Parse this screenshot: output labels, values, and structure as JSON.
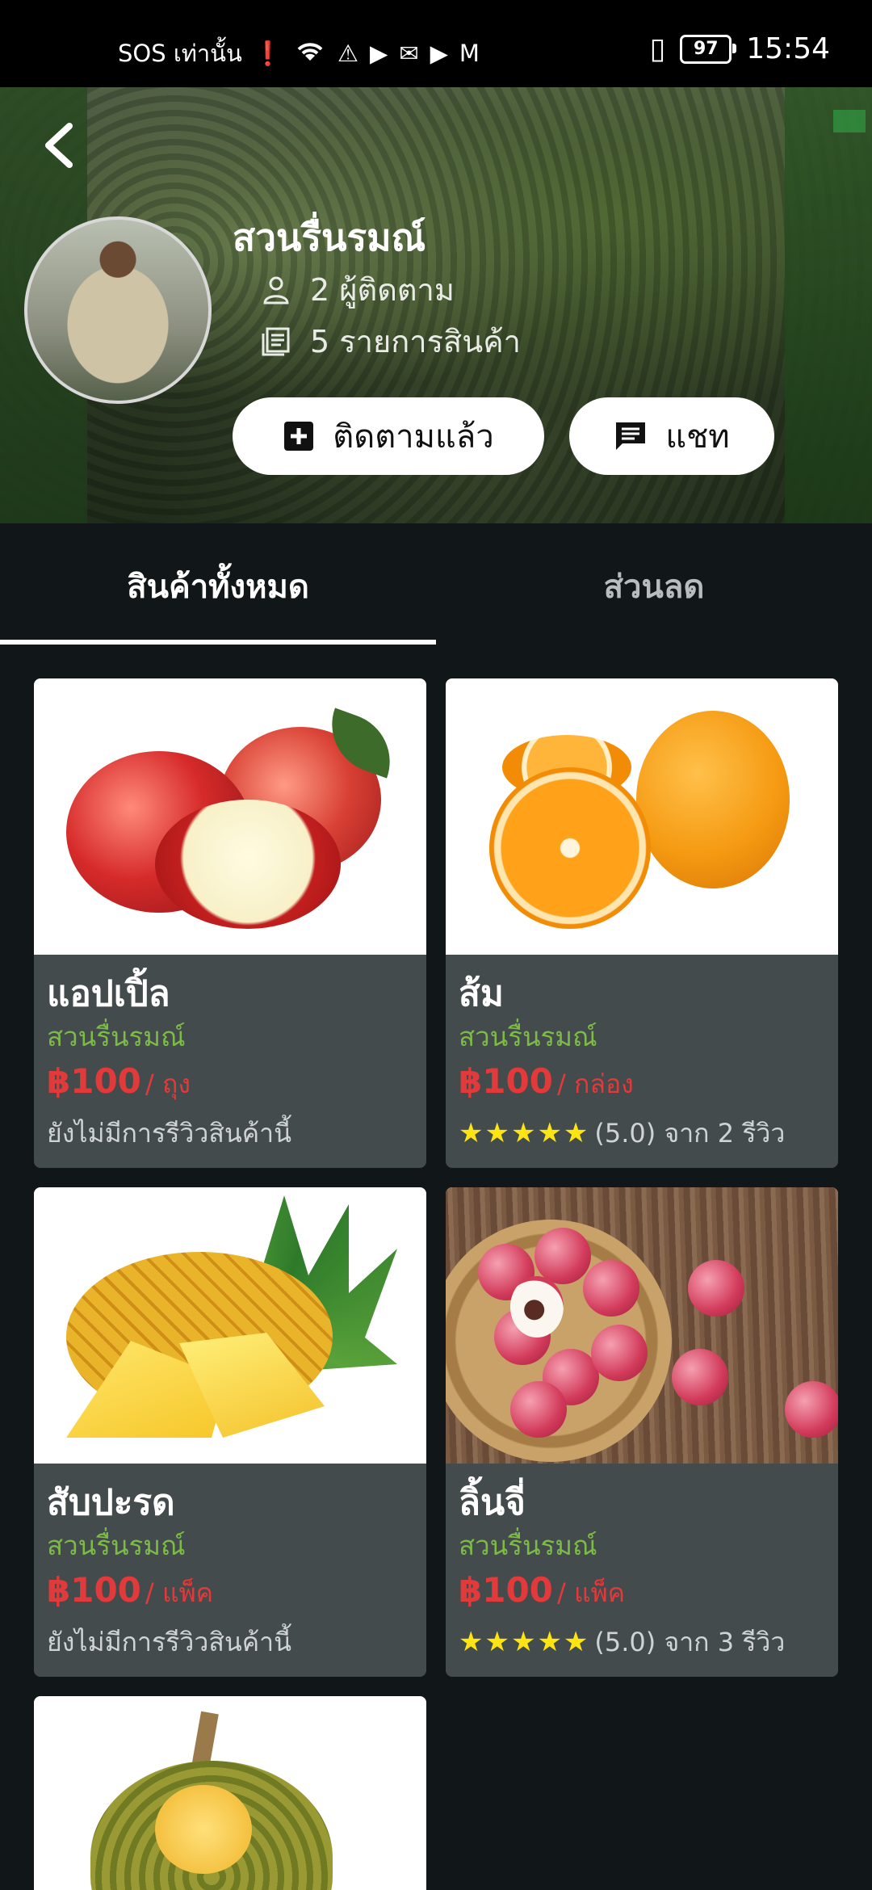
{
  "status_bar": {
    "left_text": "SOS เท่านั้น",
    "battery": "97",
    "time": "15:54"
  },
  "shop": {
    "name": "สวนรื่นรมณ์",
    "followers": "2 ผู้ติดตาม",
    "products": "5 รายการสินค้า",
    "follow_label": "ติดตามแล้ว",
    "chat_label": "แชท"
  },
  "tabs": {
    "all": "สินค้าทั้งหมด",
    "discount": "ส่วนลด"
  },
  "products": [
    {
      "name": "แอปเปิ้ล",
      "shop": "สวนรื่นรมณ์",
      "price": "฿100",
      "unit": "/ ถุง",
      "review": "ยังไม่มีการรีวิวสินค้านี้"
    },
    {
      "name": "ส้ม",
      "shop": "สวนรื่นรมณ์",
      "price": "฿100",
      "unit": "/ กล่อง",
      "rating": 5,
      "rating_text": "(5.0)",
      "review": "จาก 2 รีวิว"
    },
    {
      "name": "สับปะรด",
      "shop": "สวนรื่นรมณ์",
      "price": "฿100",
      "unit": "/ แพ็ค",
      "review": "ยังไม่มีการรีวิวสินค้านี้"
    },
    {
      "name": "ลิ้นจี่",
      "shop": "สวนรื่นรมณ์",
      "price": "฿100",
      "unit": "/ แพ็ค",
      "rating": 5,
      "rating_text": "(5.0)",
      "review": "จาก 3 รีวิว"
    }
  ],
  "colors": {
    "background": "#111718",
    "card": "#444b4c",
    "shop_green": "#7dbb47",
    "price_red": "#e23a3a",
    "star_yellow": "#ffe414"
  },
  "icons": [
    "back-icon",
    "person-icon",
    "list-icon",
    "plus-square-icon",
    "chat-icon",
    "star-icon"
  ]
}
